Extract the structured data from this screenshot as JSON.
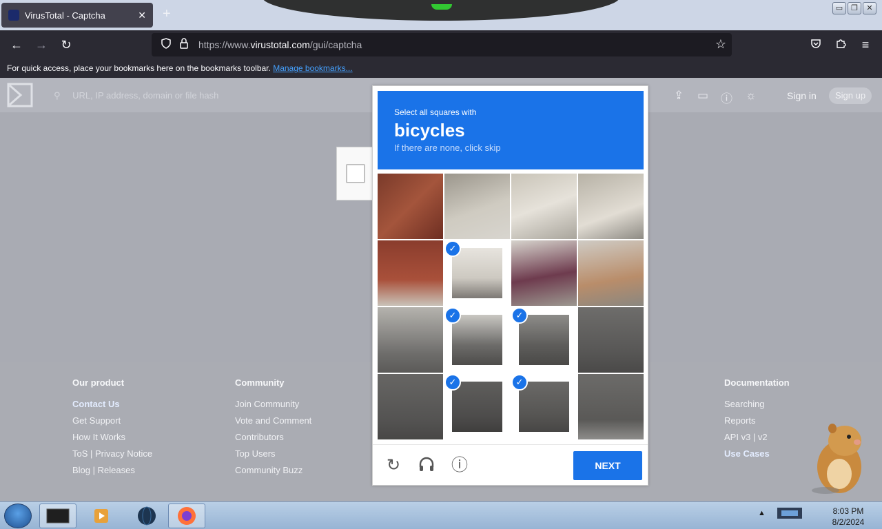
{
  "browser": {
    "tab_title": "VirusTotal - Captcha",
    "tab_close": "✕",
    "new_tab": "+",
    "window_buttons": [
      "▭",
      "❐",
      "✕"
    ],
    "url_prefix": "https://www.",
    "url_host": "virustotal.com",
    "url_path": "/gui/captcha",
    "bookmarks_text": "For quick access, place your bookmarks here on the bookmarks toolbar.",
    "bookmarks_link": "Manage bookmarks..."
  },
  "header": {
    "search_placeholder": "URL, IP address, domain or file hash",
    "sign_in": "Sign in",
    "sign_up": "Sign up"
  },
  "captcha": {
    "instruction": "Select all squares with",
    "target": "bicycles",
    "hint": "If there are none, click skip",
    "next_label": "NEXT",
    "selected_tiles": [
      5,
      9,
      10,
      13,
      14
    ]
  },
  "footer": {
    "columns": [
      {
        "heading": "Our product",
        "items": [
          "Contact Us",
          "Get Support",
          "How It Works",
          "ToS | Privacy Notice",
          "Blog | Releases"
        ]
      },
      {
        "heading": "Community",
        "items": [
          "Join Community",
          "Vote and Comment",
          "Contributors",
          "Top Users",
          "Community Buzz"
        ]
      },
      {
        "heading": "Documentation",
        "items": [
          "Searching",
          "Reports",
          "API v3 | v2",
          "Use Cases"
        ]
      }
    ]
  },
  "taskbar": {
    "time": "8:03 PM",
    "date": "8/2/2024"
  },
  "colors": {
    "accent": "#1a73e8",
    "browser_chrome": "#2b2a33",
    "page_overlay": "#a9abb3"
  }
}
